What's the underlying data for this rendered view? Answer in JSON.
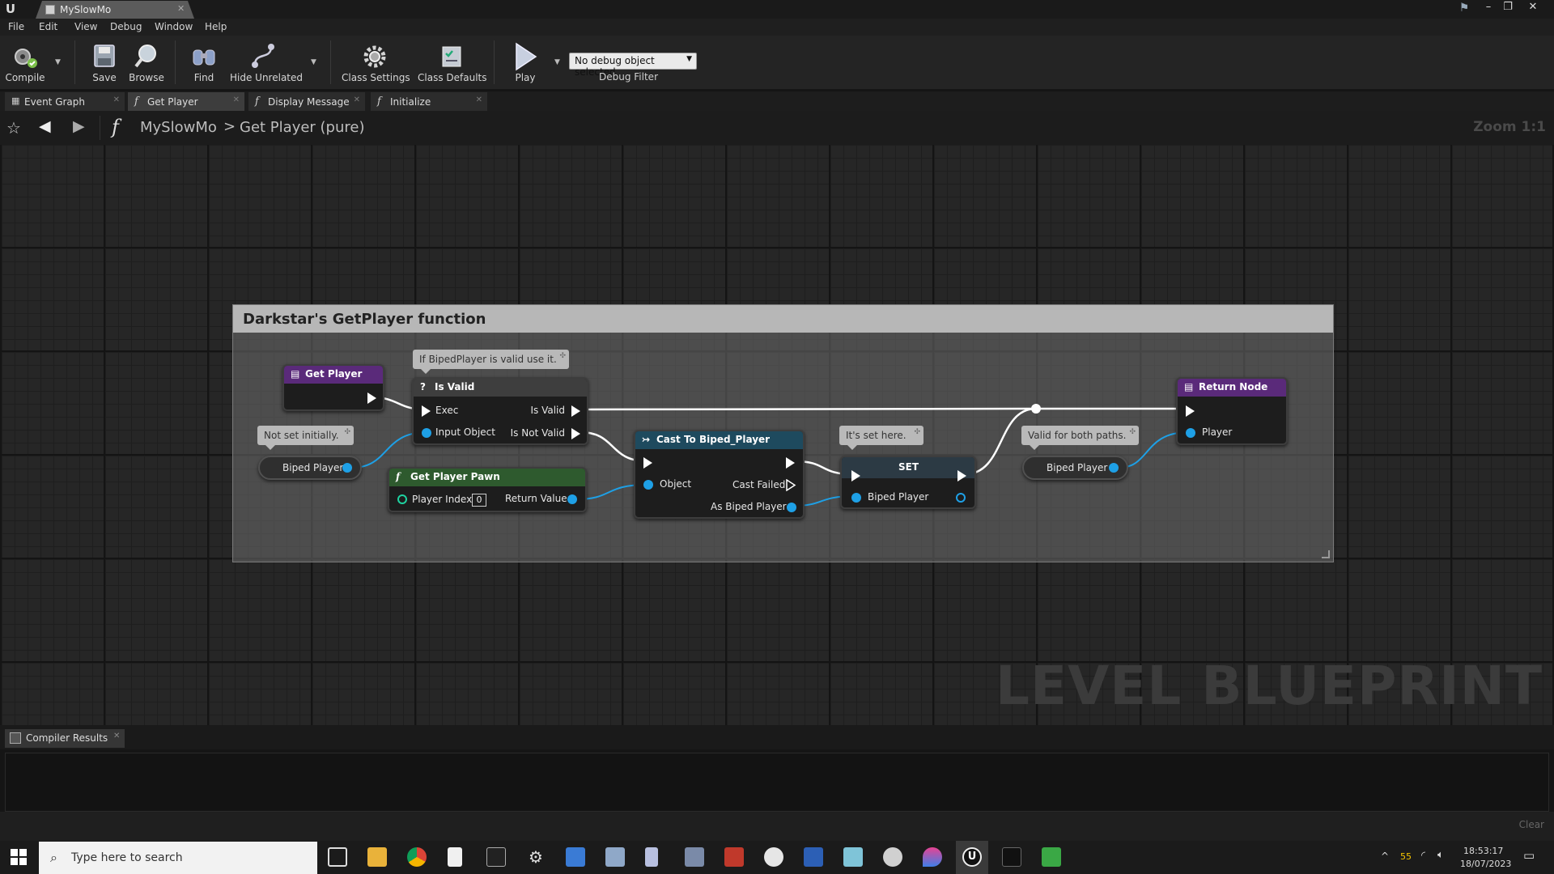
{
  "window": {
    "tab_title": "MySlowMo",
    "controls": {
      "minimize": "–",
      "restore": "❐",
      "close": "✕"
    }
  },
  "menu": [
    "File",
    "Edit",
    "View",
    "Debug",
    "Window",
    "Help"
  ],
  "toolbar": {
    "compile": "Compile",
    "save": "Save",
    "browse": "Browse",
    "find": "Find",
    "hide_unrelated": "Hide Unrelated",
    "class_settings": "Class Settings",
    "class_defaults": "Class Defaults",
    "play": "Play",
    "debug_select": "No debug object selected",
    "debug_filter": "Debug Filter"
  },
  "graph_tabs": [
    {
      "label": "Event Graph",
      "icon": "event-graph-icon"
    },
    {
      "label": "Get Player",
      "icon": "function-icon",
      "active": true
    },
    {
      "label": "Display Message",
      "icon": "function-icon"
    },
    {
      "label": "Initialize",
      "icon": "function-icon"
    }
  ],
  "breadcrumb": {
    "root": "MySlowMo",
    "separator": ">",
    "current": "Get Player (pure)",
    "zoom": "Zoom 1:1"
  },
  "graph": {
    "watermark": "LEVEL BLUEPRINT",
    "comment_title": "Darkstar's GetPlayer function",
    "bubbles": {
      "valid_use": "If BipedPlayer is valid use it.",
      "not_set": "Not set initially.",
      "set_here": "It's set here.",
      "valid_both": "Valid for both paths."
    },
    "nodes": {
      "get_player": {
        "title": "Get Player"
      },
      "is_valid": {
        "title": "Is Valid",
        "exec": "Exec",
        "input_object": "Input Object",
        "is_valid_out": "Is Valid",
        "is_not_valid_out": "Is Not Valid"
      },
      "biped_var_1": {
        "label": "Biped Player"
      },
      "get_player_pawn": {
        "title": "Get Player Pawn",
        "player_index": "Player Index",
        "index_value": "0",
        "return_value": "Return Value"
      },
      "cast": {
        "title": "Cast To Biped_Player",
        "object": "Object",
        "cast_failed": "Cast Failed",
        "as_biped": "As Biped Player"
      },
      "set": {
        "title": "SET",
        "biped": "Biped Player"
      },
      "biped_var_2": {
        "label": "Biped Player"
      },
      "return_node": {
        "title": "Return Node",
        "player": "Player"
      }
    },
    "colors": {
      "pure_function_header": "#5a2a7a",
      "function_header": "#2e5a2e",
      "cast_header": "#1e4a5e",
      "object_pin": "#1ea0e6"
    }
  },
  "compiler": {
    "tab": "Compiler Results",
    "clear": "Clear"
  },
  "taskbar": {
    "search_placeholder": "Type here to search",
    "tray_temp": "55",
    "time": "18:53:17",
    "date": "18/07/2023"
  }
}
